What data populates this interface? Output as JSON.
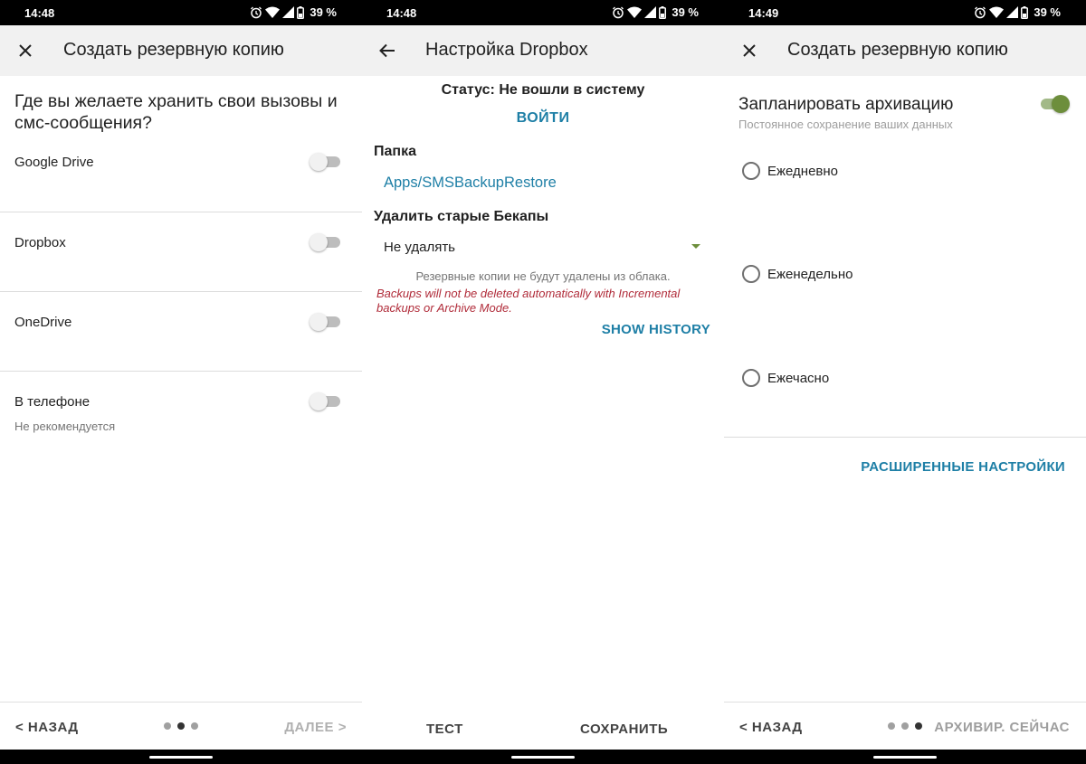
{
  "screens": [
    {
      "status": {
        "time": "14:48",
        "battery": "39 %"
      },
      "toolbar": {
        "nav_icon": "close-icon",
        "title": "Создать резервную копию"
      },
      "question": "Где вы желаете хранить свои вызовы и смс-сообщения?",
      "options": [
        {
          "label": "Google Drive",
          "enabled": false
        },
        {
          "label": "Dropbox",
          "enabled": false
        },
        {
          "label": "OneDrive",
          "enabled": false
        },
        {
          "label": "В телефоне",
          "sublabel": "Не рекомендуется",
          "enabled": false
        }
      ],
      "footer": {
        "back": "< НАЗАД",
        "next": "ДАЛЕЕ >",
        "page": 2,
        "pages": 3
      }
    },
    {
      "status": {
        "time": "14:48",
        "battery": "39 %"
      },
      "toolbar": {
        "nav_icon": "back-arrow-icon",
        "title": "Настройка Dropbox"
      },
      "status_line": "Статус: Не вошли в систему",
      "login_button": "ВОЙТИ",
      "folder": {
        "title": "Папка",
        "path": "Apps/SMSBackupRestore"
      },
      "delete_old": {
        "title": "Удалить старые Бекапы",
        "selected": "Не удалять"
      },
      "note": "Резервные копии не будут удалены из облака.",
      "warning": "Backups will not be deleted automatically with Incremental backups or Archive Mode.",
      "show_history": "SHOW HISTORY",
      "footer": {
        "test": "ТЕСТ",
        "save": "СОХРАНИТЬ"
      }
    },
    {
      "status": {
        "time": "14:49",
        "battery": "39 %"
      },
      "toolbar": {
        "nav_icon": "close-icon",
        "title": "Создать резервную копию"
      },
      "schedule": {
        "title": "Запланировать архивацию",
        "subtitle": "Постоянное сохранение ваших данных",
        "enabled": true
      },
      "frequency_options": [
        "Ежедневно",
        "Еженедельно",
        "Ежечасно"
      ],
      "advanced_button": "РАСШИРЕННЫЕ НАСТРОЙКИ",
      "footer": {
        "back": "< НАЗАД",
        "archive_now": "АРХИВИР. СЕЙЧАС",
        "page": 3,
        "pages": 3
      }
    }
  ],
  "colors": {
    "accent_blue": "#1e7fa6",
    "switch_on": "#6d8e3c",
    "warning_red": "#b02b39",
    "toolbar_bg": "#f1f1f1"
  }
}
